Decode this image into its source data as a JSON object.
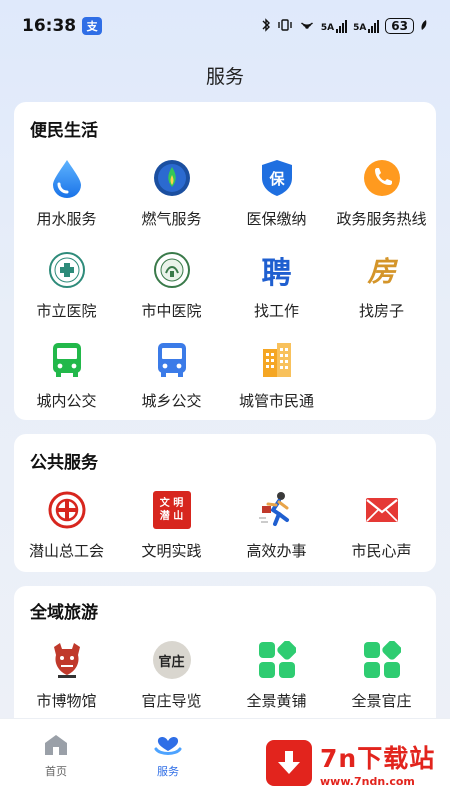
{
  "status_bar": {
    "time": "16:38",
    "app_badge": "支",
    "net1": "5A",
    "net2": "5A",
    "battery": "63"
  },
  "page": {
    "title": "服务"
  },
  "sections": [
    {
      "title": "便民生活",
      "items": [
        {
          "label": "用水服务",
          "icon": "water-drop-icon"
        },
        {
          "label": "燃气服务",
          "icon": "gas-flame-icon"
        },
        {
          "label": "医保缴纳",
          "icon": "insurance-shield-icon",
          "glyph": "保"
        },
        {
          "label": "政务服务热线",
          "icon": "phone-icon"
        },
        {
          "label": "市立医院",
          "icon": "hospital-emblem-icon"
        },
        {
          "label": "市中医院",
          "icon": "chinese-hospital-emblem-icon"
        },
        {
          "label": "找工作",
          "icon": "job-icon",
          "glyph": "聘"
        },
        {
          "label": "找房子",
          "icon": "house-icon",
          "glyph": "房"
        },
        {
          "label": "城内公交",
          "icon": "bus-green-icon"
        },
        {
          "label": "城乡公交",
          "icon": "bus-blue-icon"
        },
        {
          "label": "城管市民通",
          "icon": "building-icon"
        }
      ]
    },
    {
      "title": "公共服务",
      "items": [
        {
          "label": "潜山总工会",
          "icon": "union-emblem-icon"
        },
        {
          "label": "文明实践",
          "icon": "civilization-icon",
          "glyph_lines": [
            "文 明",
            "潜 山"
          ]
        },
        {
          "label": "高效办事",
          "icon": "running-man-icon"
        },
        {
          "label": "市民心声",
          "icon": "mail-icon"
        }
      ]
    },
    {
      "title": "全域旅游",
      "items": [
        {
          "label": "市博物馆",
          "icon": "museum-icon"
        },
        {
          "label": "官庄导览",
          "icon": "guanzhuang-icon",
          "glyph": "官庄"
        },
        {
          "label": "全景黄铺",
          "icon": "panorama-green-icon"
        },
        {
          "label": "全景官庄",
          "icon": "panorama-green-icon-2"
        }
      ]
    }
  ],
  "tabbar": {
    "tabs": [
      {
        "label": "首页",
        "icon": "home-icon",
        "active": false
      },
      {
        "label": "服务",
        "icon": "service-heart-icon",
        "active": true
      }
    ]
  },
  "watermark": {
    "name": "7n下载站",
    "url": "www.7ndn.com"
  },
  "colors": {
    "accent": "#2f6ee6",
    "card_bg": "#ffffff",
    "page_bg": "#e8eef8",
    "watermark_red": "#e2241d"
  }
}
